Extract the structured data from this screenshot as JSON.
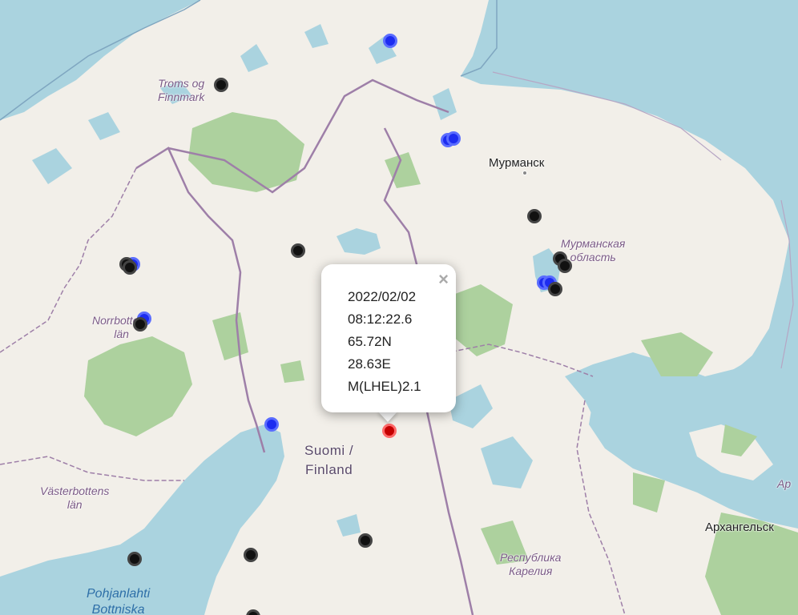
{
  "map": {
    "region_labels": [
      {
        "id": "troms",
        "lines": [
          "Troms og",
          "Finnmark"
        ]
      },
      {
        "id": "norrbotten",
        "lines": [
          "Norrbottens",
          "län"
        ]
      },
      {
        "id": "vasterbotten",
        "lines": [
          "Västerbottens",
          "län"
        ]
      },
      {
        "id": "murmansk-oblast",
        "lines": [
          "Мурманская",
          "область"
        ]
      },
      {
        "id": "karelia",
        "lines": [
          "Республика",
          "Карелия"
        ]
      },
      {
        "id": "arkh-partial",
        "lines": [
          "Ар"
        ]
      }
    ],
    "city_labels": [
      {
        "id": "murmansk",
        "text": "Мурманск"
      },
      {
        "id": "arkhangelsk",
        "text": "Архангельск"
      }
    ],
    "country_label": {
      "lines": [
        "Suomi /",
        "Finland"
      ]
    },
    "sea_label": {
      "lines": [
        "Pohjanlahti",
        "Bottniska"
      ]
    },
    "colors": {
      "water": "#aad3df",
      "land": "#f2efe9",
      "forest": "#add19e",
      "border": "#9e7fa8",
      "marker_black": "#111111",
      "marker_blue": "#1d2cf0",
      "marker_red": "#c40000"
    }
  },
  "markers": [
    {
      "type": "blue"
    },
    {
      "type": "black"
    },
    {
      "type": "blue"
    },
    {
      "type": "blue"
    },
    {
      "type": "black"
    },
    {
      "type": "black"
    },
    {
      "type": "blue"
    },
    {
      "type": "black"
    },
    {
      "type": "black"
    },
    {
      "type": "blue"
    },
    {
      "type": "black"
    },
    {
      "type": "black"
    },
    {
      "type": "black"
    },
    {
      "type": "blue"
    },
    {
      "type": "blue"
    },
    {
      "type": "black"
    },
    {
      "type": "blue"
    },
    {
      "type": "red",
      "selected": true
    },
    {
      "type": "black"
    },
    {
      "type": "black"
    },
    {
      "type": "black"
    },
    {
      "type": "black"
    }
  ],
  "popup": {
    "lines": [
      "2022/02/02",
      "08:12:22.6",
      "65.72N",
      "28.63E",
      "M(LHEL)2.1"
    ],
    "close_label": "×"
  }
}
